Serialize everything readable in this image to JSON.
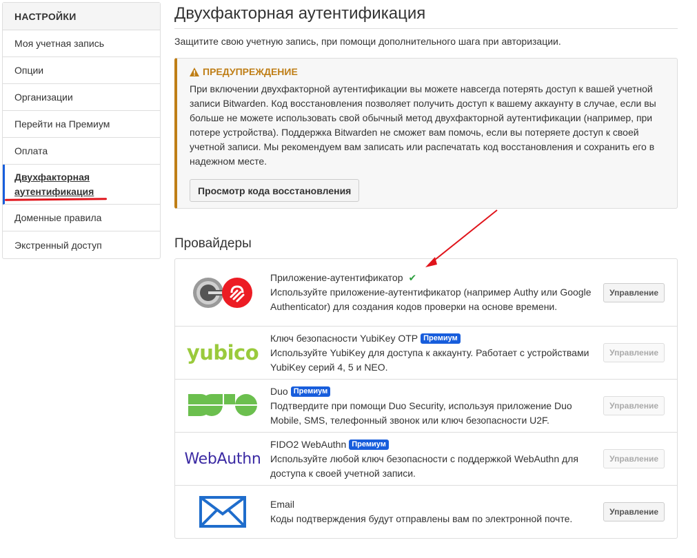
{
  "sidebar": {
    "header": "НАСТРОЙКИ",
    "items": [
      {
        "label": "Моя учетная запись"
      },
      {
        "label": "Опции"
      },
      {
        "label": "Организации"
      },
      {
        "label": "Перейти на Премиум"
      },
      {
        "label": "Оплата"
      },
      {
        "label": "Двухфакторная аутентификация"
      },
      {
        "label": "Доменные правила"
      },
      {
        "label": "Экстренный доступ"
      }
    ]
  },
  "main": {
    "title": "Двухфакторная аутентификация",
    "description": "Защитите свою учетную запись, при помощи дополнительного шага при авторизации.",
    "warning": {
      "title": "ПРЕДУПРЕЖДЕНИЕ",
      "text": "При включении двухфакторной аутентификации вы можете навсегда потерять доступ к вашей учетной записи Bitwarden. Код восстановления позволяет получить доступ к вашему аккаунту в случае, если вы больше не можете использовать свой обычный метод двухфакторной аутентификации (например, при потере устройства). Поддержка Bitwarden не сможет вам помочь, если вы потеряете доступ к своей учетной записи. Мы рекомендуем вам записать или распечатать код восстановления и сохранить его в надежном месте.",
      "button": "Просмотр кода восстановления",
      "color": "#bf7e16"
    },
    "providers_title": "Провайдеры",
    "premium_badge": "Премиум",
    "providers": [
      {
        "name": "Приложение-аутентификатор",
        "description": "Используйте приложение-аутентификатор (например Authy или Google Authenticator) для создания кодов проверки на основе времени.",
        "button": "Управление",
        "enabled": true,
        "premium": false,
        "logo": "authy-google-icon"
      },
      {
        "name": "Ключ безопасности YubiKey OTP",
        "description": "Используйте YubiKey для доступа к аккаунту. Работает с устройствами YubiKey серий 4, 5 и NEO.",
        "button": "Управление",
        "enabled": false,
        "premium": true,
        "logo": "yubico"
      },
      {
        "name": "Duo",
        "description": "Подтвердите при помощи Duo Security, используя приложение Duo Mobile, SMS, телефонный звонок или ключ безопасности U2F.",
        "button": "Управление",
        "enabled": false,
        "premium": true,
        "logo": "DUO"
      },
      {
        "name": "FIDO2 WebAuthn",
        "description": "Используйте любой ключ безопасности с поддержкой WebAuthn для доступа к своей учетной записи.",
        "button": "Управление",
        "enabled": false,
        "premium": true,
        "logo": "WebAuthn"
      },
      {
        "name": "Email",
        "description": "Коды подтверждения будут отправлены вам по электронной почте.",
        "button": "Управление",
        "enabled": false,
        "premium": false,
        "logo": "email-envelope-icon"
      }
    ]
  },
  "colors": {
    "accent": "#175ddc",
    "annotation_red": "#e0141b",
    "check_green": "#2c9f3e",
    "yubico_green": "#9aca3c",
    "duo_green": "#6bbf4e",
    "webauthn_purple": "#3b2aa3"
  }
}
